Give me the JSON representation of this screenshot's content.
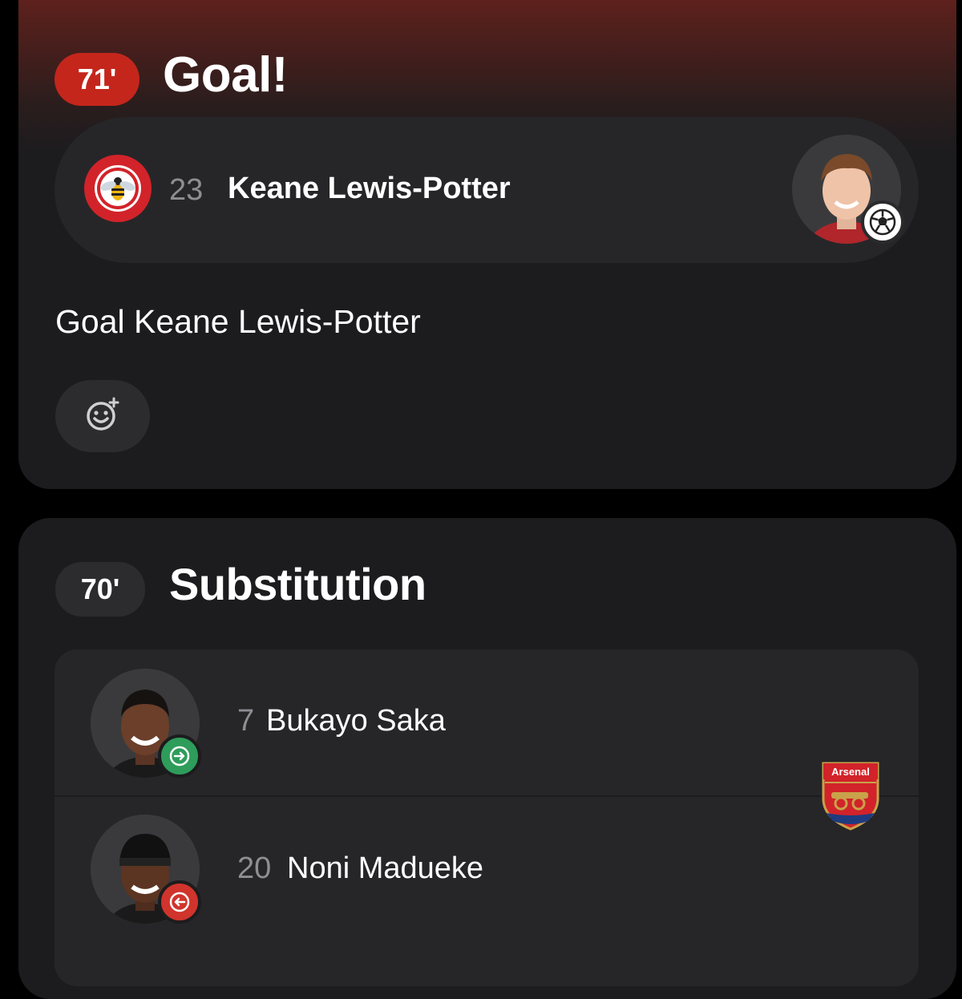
{
  "goal_event": {
    "minute": "71'",
    "title": "Goal!",
    "player_number": "23",
    "player_name": "Keane Lewis-Potter",
    "description": "Goal Keane Lewis-Potter",
    "club_logo": "brentford-crest",
    "club_logo_text": "BRENTFORD FOOTBALL CLUB",
    "badge_color": "#c4261c"
  },
  "sub_event": {
    "minute": "70'",
    "title": "Substitution",
    "player_in": {
      "number": "7",
      "name": "Bukayo Saka"
    },
    "player_out": {
      "number": "20",
      "name": "Noni Madueke"
    },
    "club_logo": "arsenal-crest",
    "club_logo_text": "Arsenal",
    "in_color": "#2e9c5a",
    "out_color": "#d0342c"
  }
}
